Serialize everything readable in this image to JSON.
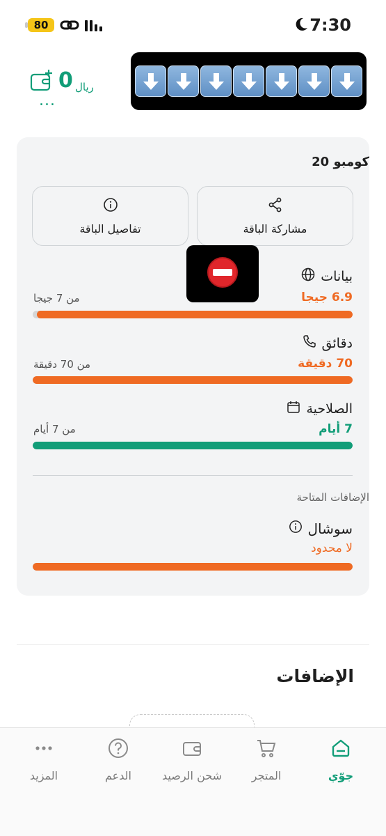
{
  "status_bar": {
    "battery": "80",
    "time": "7:30"
  },
  "header": {
    "balance_value": "0",
    "currency": "ريال",
    "more": "..."
  },
  "plan": {
    "name": "كومبو 20",
    "share_label": "مشاركة الباقة",
    "details_label": "تفاصيل الباقة"
  },
  "usage": {
    "data": {
      "title": "بيانات",
      "value": "6.9 جيجا",
      "total": "من 7 جيجا",
      "fraction": 0.986
    },
    "minutes": {
      "title": "دقائق",
      "value": "70 دقيقة",
      "total": "من 70 دقيقة",
      "fraction": 1.0
    },
    "validity": {
      "title": "الصلاحية",
      "value": "7 أيام",
      "total": "من 7 أيام",
      "fraction": 1.0
    }
  },
  "addons": {
    "available_label": "الإضافات المتاحة",
    "social_title": "سوشال",
    "social_value": "لا محدود",
    "social_fraction": 1.0,
    "heading": "الإضافات"
  },
  "nav": {
    "home": "جوّي",
    "store": "المتجر",
    "topup": "شحن الرصيد",
    "support": "الدعم",
    "more": "المزيد"
  },
  "colors": {
    "accent": "#119d78",
    "orange": "#ef6a23"
  }
}
